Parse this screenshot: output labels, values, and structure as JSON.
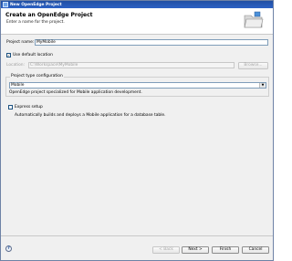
{
  "window": {
    "title": "New OpenEdge Project"
  },
  "header": {
    "title": "Create an OpenEdge Project",
    "subtitle": "Enter a name for the project."
  },
  "project_name": {
    "label": "Project name:",
    "value": "MyMobile"
  },
  "use_default_location": {
    "label": "Use default location",
    "checked": true
  },
  "location": {
    "label": "Location:",
    "value": "C:\\Workspace\\MyMobile",
    "browse_label": "Browse..."
  },
  "project_type": {
    "group_label": "Project type configuration",
    "selected": "Mobile",
    "description": "OpenEdge project specialized for Mobile application development."
  },
  "express_setup": {
    "label": "Express setup",
    "checked": false,
    "description": "Automatically builds and deploys a Mobile application for a database table."
  },
  "buttons": {
    "back": "< Back",
    "next": "Next >",
    "finish": "Finish",
    "cancel": "Cancel"
  },
  "icons": {
    "help": "help-icon",
    "wizard": "folder-icon"
  }
}
